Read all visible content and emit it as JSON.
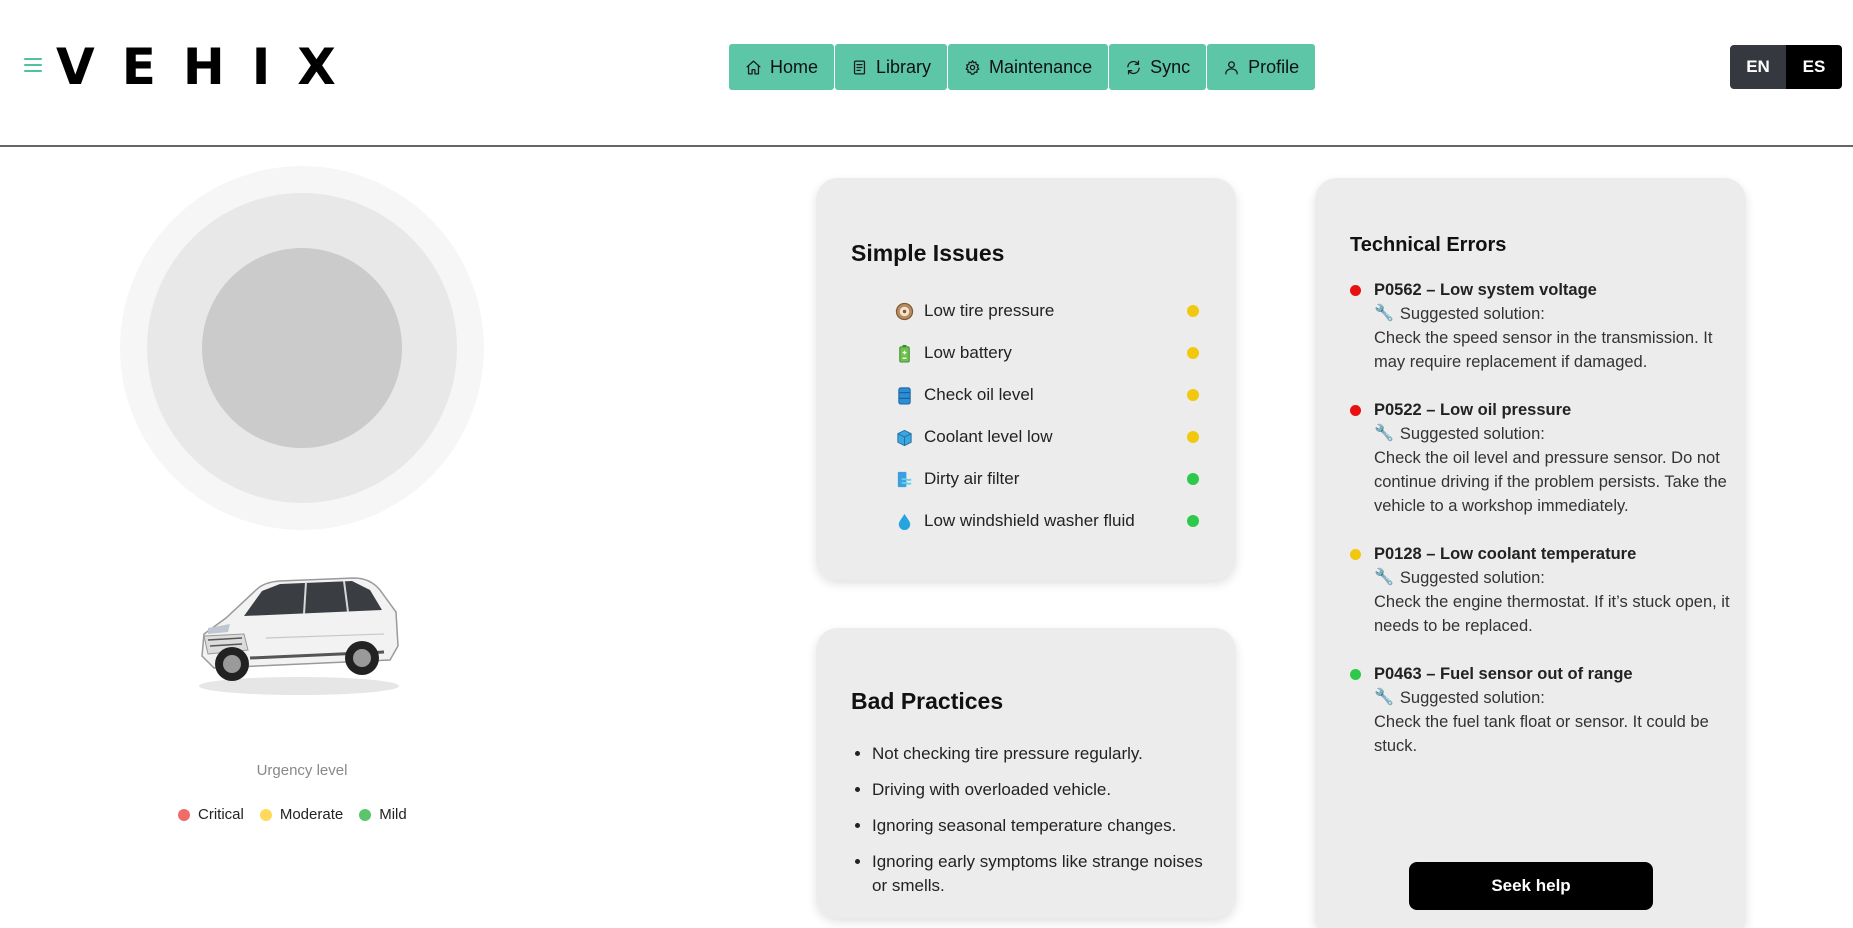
{
  "brand": {
    "name": "VEHIX"
  },
  "nav": [
    {
      "label": "Home",
      "icon": "home-icon"
    },
    {
      "label": "Library",
      "icon": "library-icon"
    },
    {
      "label": "Maintenance",
      "icon": "gear-icon"
    },
    {
      "label": "Sync",
      "icon": "sync-icon"
    },
    {
      "label": "Profile",
      "icon": "user-icon"
    }
  ],
  "language": {
    "en": "EN",
    "es": "ES",
    "selected": "EN"
  },
  "urgency": {
    "label": "Urgency level",
    "legend": [
      {
        "label": "Critical",
        "color": "#f26b6b"
      },
      {
        "label": "Moderate",
        "color": "#ffd95a"
      },
      {
        "label": "Mild",
        "color": "#5cc46a"
      }
    ]
  },
  "simple_issues": {
    "title": "Simple Issues",
    "items": [
      {
        "label": "Low tire pressure",
        "icon": "tire-icon",
        "color": "#f2c80f"
      },
      {
        "label": "Low battery",
        "icon": "battery-icon",
        "color": "#f2c80f"
      },
      {
        "label": "Check oil level",
        "icon": "oil-barrel-icon",
        "color": "#f2c80f"
      },
      {
        "label": "Coolant level low",
        "icon": "coolant-box-icon",
        "color": "#f2c80f"
      },
      {
        "label": "Dirty air filter",
        "icon": "air-filter-icon",
        "color": "#2ec94a"
      },
      {
        "label": "Low windshield washer fluid",
        "icon": "droplet-icon",
        "color": "#2ec94a"
      }
    ]
  },
  "bad_practices": {
    "title": "Bad Practices",
    "items": [
      "Not checking tire pressure regularly.",
      "Driving with overloaded vehicle.",
      "Ignoring seasonal temperature changes.",
      "Ignoring early symptoms like strange noises or smells."
    ]
  },
  "technical_errors": {
    "title": "Technical Errors",
    "solution_label": "Suggested solution:",
    "items": [
      {
        "code": "P0562 – Low system voltage",
        "solution": "Check the speed sensor in the transmission. It may require replacement if damaged.",
        "color": "#e81010"
      },
      {
        "code": "P0522 – Low oil pressure",
        "solution": "Check the oil level and pressure sensor. Do not continue driving if the problem persists. Take the vehicle to a workshop immediately.",
        "color": "#e81010"
      },
      {
        "code": "P0128 – Low coolant temperature",
        "solution": "Check the engine thermostat. If it’s stuck open, it needs to be replaced.",
        "color": "#f2c80f"
      },
      {
        "code": "P0463 – Fuel sensor out of range",
        "solution": "Check the fuel tank float or sensor. It could be stuck.",
        "color": "#2ec94a"
      }
    ],
    "cta": "Seek help"
  }
}
